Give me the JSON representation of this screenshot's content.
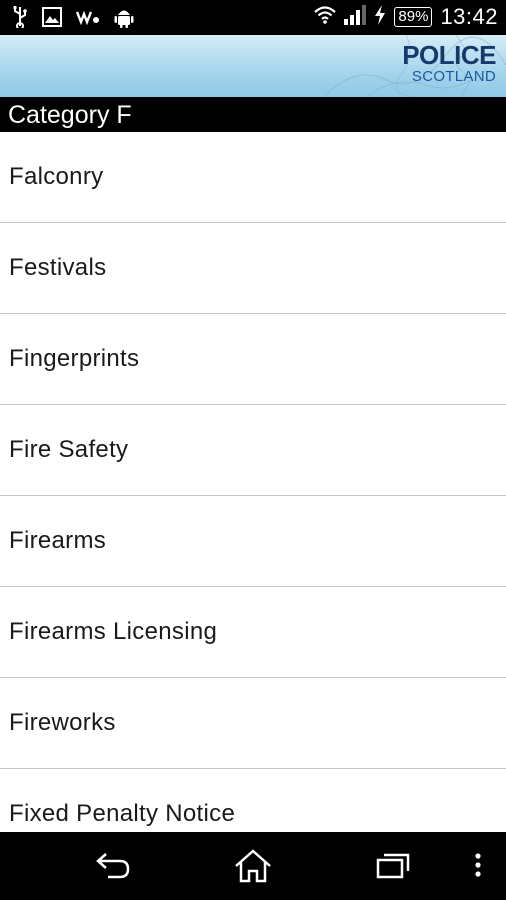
{
  "status_bar": {
    "battery_percent": "89%",
    "time": "13:42",
    "icons": [
      "usb-icon",
      "image-icon",
      "walkman-icon",
      "android-icon",
      "wifi-icon",
      "signal-icon",
      "charging-icon",
      "battery-icon"
    ]
  },
  "header": {
    "logo_line1": "POLICE",
    "logo_line2": "SCOTLAND"
  },
  "category": {
    "title": "Category F"
  },
  "list": {
    "items": [
      {
        "label": "Falconry"
      },
      {
        "label": "Festivals"
      },
      {
        "label": "Fingerprints"
      },
      {
        "label": "Fire Safety"
      },
      {
        "label": "Firearms"
      },
      {
        "label": "Firearms Licensing"
      },
      {
        "label": "Fireworks"
      },
      {
        "label": "Fixed Penalty Notice"
      }
    ]
  },
  "nav_bar": {
    "icons": [
      "back-icon",
      "home-icon",
      "recent-apps-icon",
      "menu-icon"
    ]
  }
}
